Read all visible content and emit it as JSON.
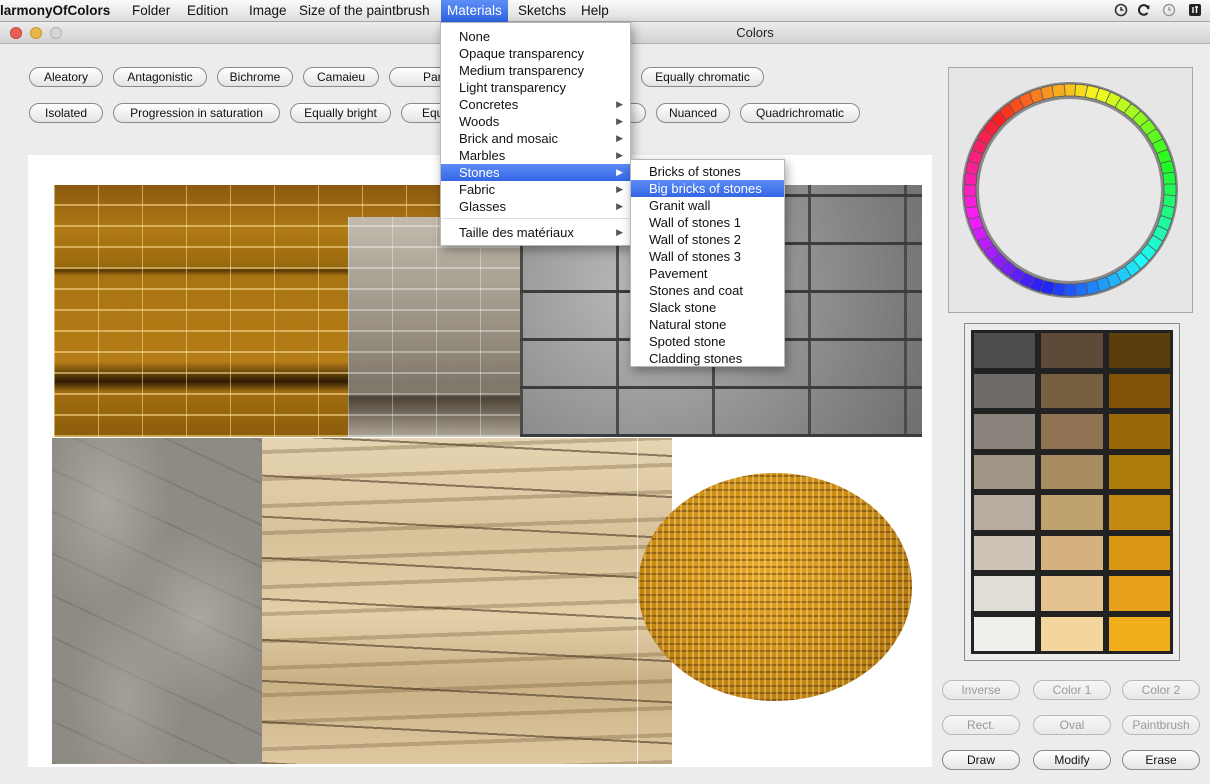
{
  "menubar": {
    "app_name": "larmonyOfColors",
    "items": [
      "Folder",
      "Edition",
      "Image",
      "Size of the paintbrush",
      "Materials",
      "Sketchs",
      "Help"
    ],
    "active": "Materials"
  },
  "window": {
    "title_partial": "Colors"
  },
  "harmony_buttons": {
    "row1": [
      "Aleatory",
      "Antagonistic",
      "Bichrome",
      "Camaieu",
      "Part",
      "Equally chromatic"
    ],
    "row2": [
      "Isolated",
      "Progression in saturation",
      "Equally bright",
      "Equa",
      "",
      "Nuanced",
      "Quadrichromatic"
    ]
  },
  "materials_menu": {
    "items": [
      {
        "label": "None",
        "submenu": false
      },
      {
        "label": "Opaque transparency",
        "submenu": false
      },
      {
        "label": "Medium transparency",
        "submenu": false
      },
      {
        "label": "Light transparency",
        "submenu": false
      },
      {
        "label": "Concretes",
        "submenu": true
      },
      {
        "label": "Woods",
        "submenu": true
      },
      {
        "label": "Brick and mosaic",
        "submenu": true
      },
      {
        "label": "Marbles",
        "submenu": true
      },
      {
        "label": "Stones",
        "submenu": true
      },
      {
        "label": "Fabric",
        "submenu": true
      },
      {
        "label": "Glasses",
        "submenu": true
      },
      {
        "label": "Taille des matériaux",
        "submenu": true
      }
    ],
    "highlighted": "Stones",
    "arrow_glyph": "▶"
  },
  "stones_submenu": {
    "items": [
      "Bricks of stones",
      "Big bricks of stones",
      "Granit wall",
      "Wall of stones 1",
      "Wall of stones 2",
      "Wall of stones 3",
      "Pavement",
      "Stones and coat",
      "Slack stone",
      "Natural stone",
      "Spoted stone",
      "Cladding stones"
    ],
    "highlighted": "Big bricks of stones"
  },
  "palette": {
    "columns": [
      [
        "#4d4d50",
        "#6d6a68",
        "#8a847c",
        "#a19586",
        "#b8ab9f",
        "#cdc3b6",
        "#e0dcd6",
        "#f1efeb"
      ],
      [
        "#5e4a37",
        "#76603f",
        "#8f7352",
        "#a78c62",
        "#bfa36c",
        "#d5b17e",
        "#e5c38e",
        "#f4d59d"
      ],
      [
        "#5b3e0c",
        "#7f5205",
        "#986808",
        "#ad7c0c",
        "#c38910",
        "#d99713",
        "#e9a11d",
        "#f2ad1a"
      ]
    ]
  },
  "tool_buttons": {
    "row1": [
      "Inverse",
      "Color 1",
      "Color 2"
    ],
    "row2": [
      "Rect.",
      "Oval",
      "Paintbrush"
    ],
    "row3": [
      "Draw",
      "Modify",
      "Erase"
    ]
  },
  "tray": {
    "icons": [
      "clock-icon",
      "sync-icon",
      "time-machine-icon",
      "script-icon"
    ]
  }
}
